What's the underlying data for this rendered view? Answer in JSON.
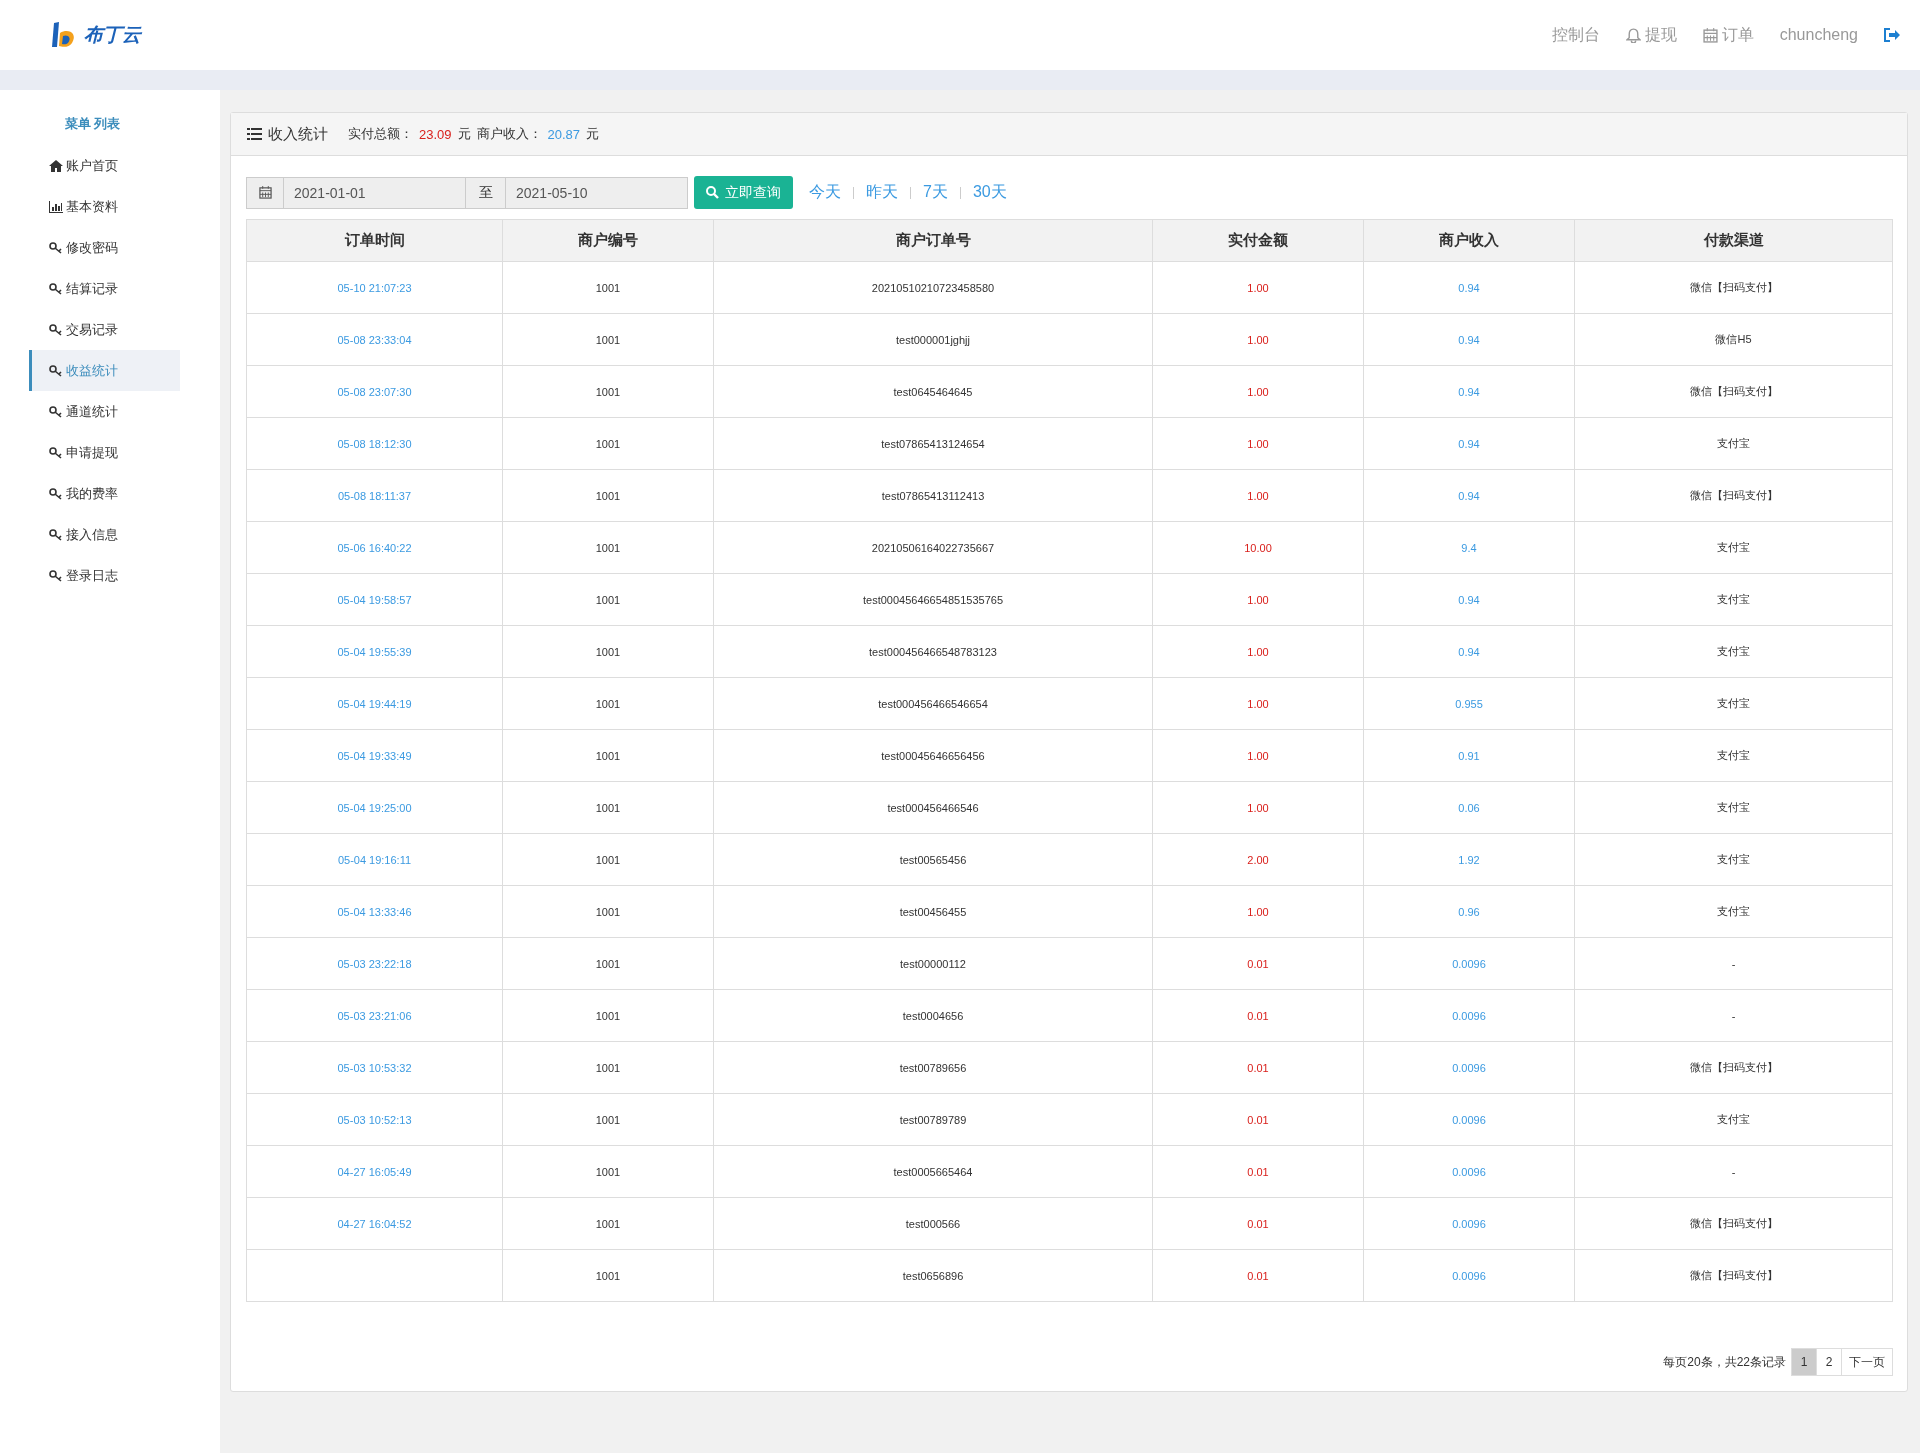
{
  "header": {
    "logo_text": "布丁云",
    "nav": [
      {
        "label": "控制台",
        "kind": "plain"
      },
      {
        "label": "提现",
        "kind": "bell"
      },
      {
        "label": "订单",
        "kind": "calendar"
      },
      {
        "label": "chuncheng",
        "kind": "plain"
      }
    ]
  },
  "sidebar": {
    "title": "菜单 列表",
    "items": [
      {
        "label": "账户首页",
        "kind": "home",
        "selected": false
      },
      {
        "label": "基本资料",
        "kind": "chart",
        "selected": false
      },
      {
        "label": "修改密码",
        "kind": "key",
        "selected": false
      },
      {
        "label": "结算记录",
        "kind": "key",
        "selected": false
      },
      {
        "label": "交易记录",
        "kind": "key",
        "selected": false
      },
      {
        "label": "收益统计",
        "kind": "key",
        "selected": true
      },
      {
        "label": "通道统计",
        "kind": "key",
        "selected": false
      },
      {
        "label": "申请提现",
        "kind": "key",
        "selected": false
      },
      {
        "label": "我的费率",
        "kind": "key",
        "selected": false
      },
      {
        "label": "接入信息",
        "kind": "key",
        "selected": false
      },
      {
        "label": "登录日志",
        "kind": "key",
        "selected": false
      }
    ]
  },
  "panel": {
    "title": "收入统计",
    "total_label": "实付总额：",
    "total_value": "23.09",
    "total_unit": "元",
    "income_label": "商户收入：",
    "income_value": "20.87",
    "income_unit": "元"
  },
  "filter": {
    "start_date": "2021-01-01",
    "separator": "至",
    "end_date": "2021-05-10",
    "query_button": "立即查询",
    "quick_ranges": [
      "今天",
      "昨天",
      "7天",
      "30天"
    ]
  },
  "table": {
    "columns": [
      "订单时间",
      "商户编号",
      "商户订单号",
      "实付金额",
      "商户收入",
      "付款渠道"
    ],
    "rows": [
      [
        "05-10 21:07:23",
        "1001",
        "20210510210723458580",
        "1.00",
        "0.94",
        "微信【扫码支付】"
      ],
      [
        "05-08 23:33:04",
        "1001",
        "test000001jghjj",
        "1.00",
        "0.94",
        "微信H5"
      ],
      [
        "05-08 23:07:30",
        "1001",
        "test0645464645",
        "1.00",
        "0.94",
        "微信【扫码支付】"
      ],
      [
        "05-08 18:12:30",
        "1001",
        "test07865413124654",
        "1.00",
        "0.94",
        "支付宝"
      ],
      [
        "05-08 18:11:37",
        "1001",
        "test07865413112413",
        "1.00",
        "0.94",
        "微信【扫码支付】"
      ],
      [
        "05-06 16:40:22",
        "1001",
        "20210506164022735667",
        "10.00",
        "9.4",
        "支付宝"
      ],
      [
        "05-04 19:58:57",
        "1001",
        "test00045646654851535765",
        "1.00",
        "0.94",
        "支付宝"
      ],
      [
        "05-04 19:55:39",
        "1001",
        "test000456466548783123",
        "1.00",
        "0.94",
        "支付宝"
      ],
      [
        "05-04 19:44:19",
        "1001",
        "test000456466546654",
        "1.00",
        "0.955",
        "支付宝"
      ],
      [
        "05-04 19:33:49",
        "1001",
        "test00045646656456",
        "1.00",
        "0.91",
        "支付宝"
      ],
      [
        "05-04 19:25:00",
        "1001",
        "test000456466546",
        "1.00",
        "0.06",
        "支付宝"
      ],
      [
        "05-04 19:16:11",
        "1001",
        "test00565456",
        "2.00",
        "1.92",
        "支付宝"
      ],
      [
        "05-04 13:33:46",
        "1001",
        "test00456455",
        "1.00",
        "0.96",
        "支付宝"
      ],
      [
        "05-03 23:22:18",
        "1001",
        "test00000112",
        "0.01",
        "0.0096",
        "-"
      ],
      [
        "05-03 23:21:06",
        "1001",
        "test0004656",
        "0.01",
        "0.0096",
        "-"
      ],
      [
        "05-03 10:53:32",
        "1001",
        "test00789656",
        "0.01",
        "0.0096",
        "微信【扫码支付】"
      ],
      [
        "05-03 10:52:13",
        "1001",
        "test00789789",
        "0.01",
        "0.0096",
        "支付宝"
      ],
      [
        "04-27 16:05:49",
        "1001",
        "test0005665464",
        "0.01",
        "0.0096",
        "-"
      ],
      [
        "04-27 16:04:52",
        "1001",
        "test000566",
        "0.01",
        "0.0096",
        "微信【扫码支付】"
      ],
      [
        "",
        "1001",
        "test0656896",
        "0.01",
        "0.0096",
        "微信【扫码支付】"
      ]
    ]
  },
  "pagination": {
    "summary": "每页20条，共22条记录",
    "pages": [
      {
        "label": "1",
        "selected": true
      },
      {
        "label": "2",
        "selected": false
      }
    ],
    "next": "下一页"
  }
}
